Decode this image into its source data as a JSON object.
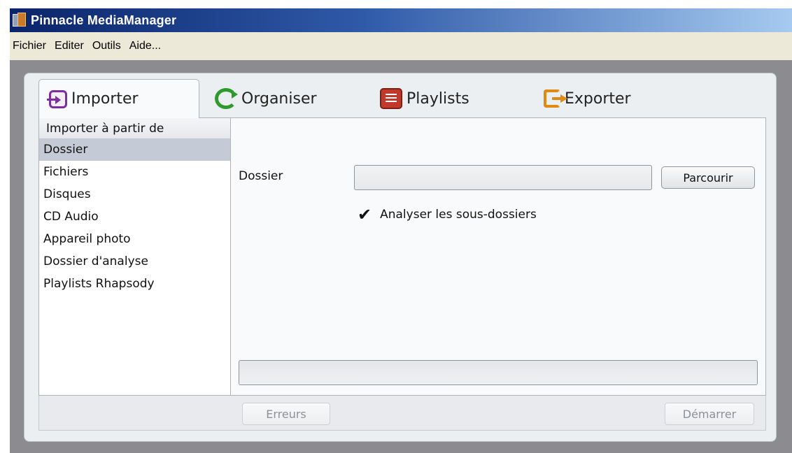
{
  "window": {
    "title": "Pinnacle MediaManager"
  },
  "menu": [
    "Fichier",
    "Editer",
    "Outils",
    "Aide..."
  ],
  "tabs": [
    {
      "label": "Importer",
      "icon": "import-icon",
      "active": true
    },
    {
      "label": "Organiser",
      "icon": "organise-icon",
      "active": false
    },
    {
      "label": "Playlists",
      "icon": "playlist-icon",
      "active": false
    },
    {
      "label": "Exporter",
      "icon": "export-icon",
      "active": false
    }
  ],
  "sidebar": {
    "heading": "Importer à partir de",
    "items": [
      {
        "label": "Dossier",
        "selected": true
      },
      {
        "label": "Fichiers",
        "selected": false
      },
      {
        "label": "Disques",
        "selected": false
      },
      {
        "label": "CD Audio",
        "selected": false
      },
      {
        "label": "Appareil photo",
        "selected": false
      },
      {
        "label": "Dossier d'analyse",
        "selected": false
      },
      {
        "label": "Playlists Rhapsody",
        "selected": false
      }
    ]
  },
  "main": {
    "folder_label": "Dossier",
    "folder_value": "",
    "browse_label": "Parcourir",
    "subfolders_label": "Analyser les sous-dossiers",
    "subfolders_checked": true,
    "progress": 0
  },
  "footer": {
    "errors_label": "Erreurs",
    "start_label": "Démarrer"
  },
  "colors": {
    "selected_row": "#c5cbd6",
    "titlebar": "#0a246a",
    "disabled_text": "#8d9196"
  }
}
